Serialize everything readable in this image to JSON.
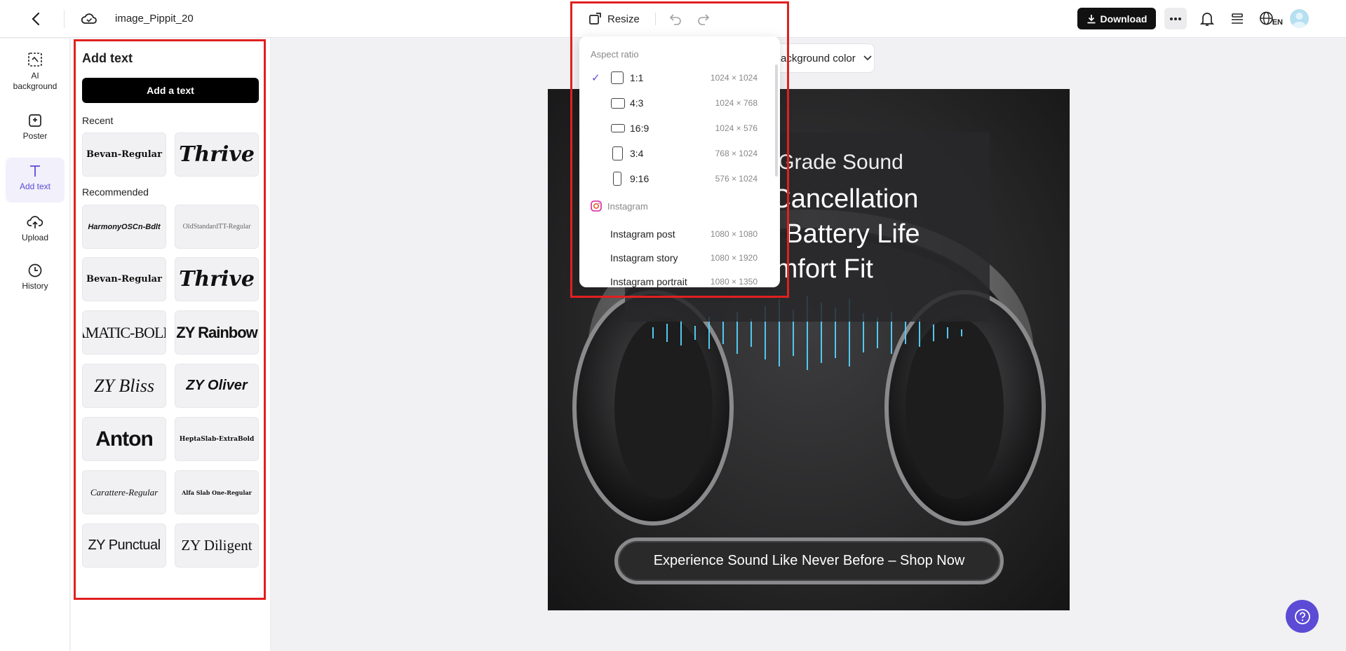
{
  "topbar": {
    "project_name": "image_Pippit_20",
    "resize_label": "Resize",
    "download_label": "Download",
    "lang_label": "EN"
  },
  "rail": {
    "items": [
      {
        "label": "AI background",
        "icon": "ai-background-icon"
      },
      {
        "label": "Poster",
        "icon": "poster-icon"
      },
      {
        "label": "Add text",
        "icon": "text-icon"
      },
      {
        "label": "Upload",
        "icon": "upload-icon"
      },
      {
        "label": "History",
        "icon": "history-icon"
      }
    ]
  },
  "panel": {
    "title": "Add text",
    "add_button": "Add a text",
    "recent_label": "Recent",
    "recommended_label": "Recommended",
    "recent_fonts": [
      "Bevan-Regular",
      "Thrive"
    ],
    "recommended_fonts": [
      "HarmonyOSCn-Bdlt",
      "OldStandardTT-Regular",
      "Bevan-Regular",
      "Thrive",
      "AMATIC-BOLD",
      "ZY Rainbow",
      "ZY Bliss",
      "ZY Oliver",
      "Anton",
      "HeptaSlab-ExtraBold",
      "Carattere-Regular",
      "Alfa Slab One-Regular",
      "ZY Punctual",
      "ZY Diligent"
    ]
  },
  "canvas": {
    "background_color_label": "Background color",
    "line1": "Studio-Grade Sound",
    "line2": "Noise Cancellation",
    "line3": "Longer Battery Life",
    "line4": "Comfort Fit",
    "cta": "Experience Sound Like Never Before – Shop Now"
  },
  "resize_menu": {
    "aspect_label": "Aspect ratio",
    "ratios": [
      {
        "label": "1:1",
        "size": "1024 × 1024",
        "selected": true
      },
      {
        "label": "4:3",
        "size": "1024 × 768",
        "selected": false
      },
      {
        "label": "16:9",
        "size": "1024 × 576",
        "selected": false
      },
      {
        "label": "3:4",
        "size": "768 × 1024",
        "selected": false
      },
      {
        "label": "9:16",
        "size": "576 × 1024",
        "selected": false
      }
    ],
    "instagram_label": "Instagram",
    "instagram": [
      {
        "label": "Instagram post",
        "size": "1080 × 1080"
      },
      {
        "label": "Instagram story",
        "size": "1080 × 1920"
      },
      {
        "label": "Instagram portrait",
        "size": "1080 × 1350"
      }
    ]
  },
  "colors": {
    "accent": "#5b4bd5",
    "highlight_box": "#e02020"
  }
}
